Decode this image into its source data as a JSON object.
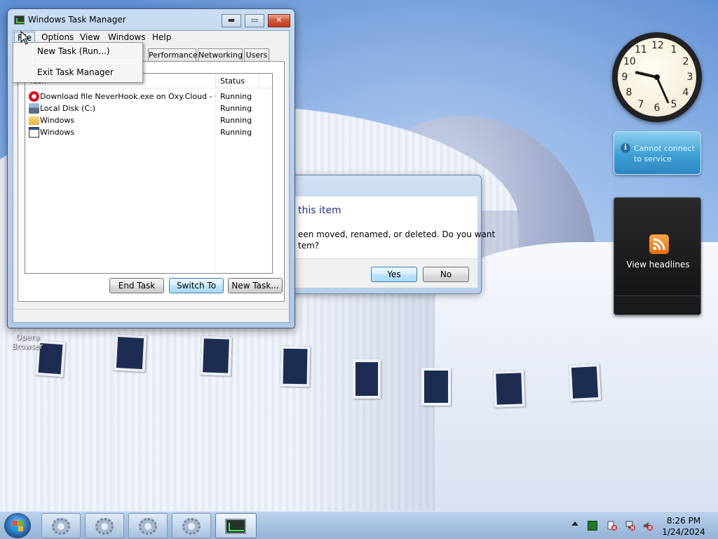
{
  "desktop": {
    "icons": [
      {
        "label": "Opera Browser"
      }
    ]
  },
  "gadgets": {
    "clock": {
      "numbers": [
        "12",
        "1",
        "2",
        "3",
        "4",
        "5",
        "6",
        "7",
        "8",
        "9",
        "10",
        "11"
      ]
    },
    "weather": {
      "message": "Cannot connect to service"
    },
    "feed": {
      "label": "View headlines",
      "icon": "rss-icon"
    }
  },
  "dialog": {
    "heading": "this item",
    "body_line1": "een moved, renamed, or deleted. Do you want",
    "body_line2": "tem?",
    "yes_label": "Yes",
    "no_label": "No"
  },
  "task_manager": {
    "title": "Windows Task Manager",
    "caption": {
      "minimize": "▬",
      "maximize": "▭",
      "close": "✕"
    },
    "menu": [
      "File",
      "Options",
      "View",
      "Windows",
      "Help"
    ],
    "tabs": [
      "Performance",
      "Networking",
      "Users"
    ],
    "columns": {
      "task": "Task",
      "status": "Status"
    },
    "rows": [
      {
        "task": "Download file NeverHook.exe on Oxy.Cloud - O...",
        "status": "Running",
        "icon": "opera-icon"
      },
      {
        "task": "Local Disk (C:)",
        "status": "Running",
        "icon": "disk-icon"
      },
      {
        "task": "Windows",
        "status": "Running",
        "icon": "folder-icon"
      },
      {
        "task": "Windows",
        "status": "Running",
        "icon": "window-icon"
      }
    ],
    "buttons": {
      "end_task": "End Task",
      "switch_to": "Switch To",
      "new_task": "New Task..."
    },
    "file_menu": {
      "new_task": "New Task (Run...)",
      "exit": "Exit Task Manager"
    }
  },
  "taskbar": {
    "clock_time": "8:26 PM",
    "clock_date": "1/24/2024",
    "colors": {
      "start_orb": "#2a6fb8"
    }
  }
}
